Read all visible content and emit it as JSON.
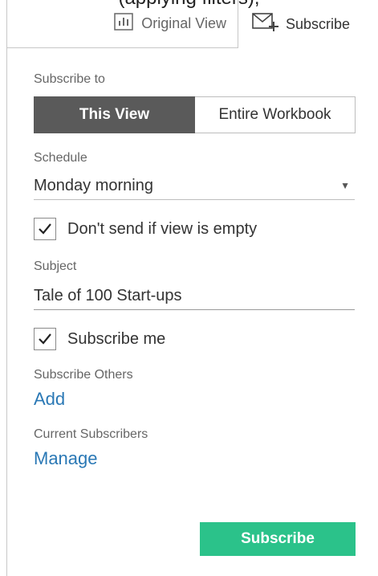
{
  "caption": "(applying filters),",
  "tabs": {
    "original_view": {
      "label": "Original View",
      "icon": "bar-chart-icon"
    },
    "subscribe": {
      "label": "Subscribe",
      "icon": "mail-plus-icon"
    }
  },
  "form": {
    "subscribe_to_label": "Subscribe to",
    "subscribe_to_options": [
      "This View",
      "Entire Workbook"
    ],
    "subscribe_to_selected": "This View",
    "schedule_label": "Schedule",
    "schedule_value": "Monday morning",
    "dont_send_label": "Don't send if view is empty",
    "dont_send_checked": true,
    "subject_label": "Subject",
    "subject_value": "Tale of 100 Start-ups",
    "subscribe_me_label": "Subscribe me",
    "subscribe_me_checked": true,
    "subscribe_others_label": "Subscribe Others",
    "add_link": "Add",
    "current_subscribers_label": "Current Subscribers",
    "manage_link": "Manage",
    "submit_label": "Subscribe"
  },
  "colors": {
    "accent_green": "#2bc28a",
    "link_blue": "#2a78b5",
    "segment_active": "#5a5a5a"
  }
}
